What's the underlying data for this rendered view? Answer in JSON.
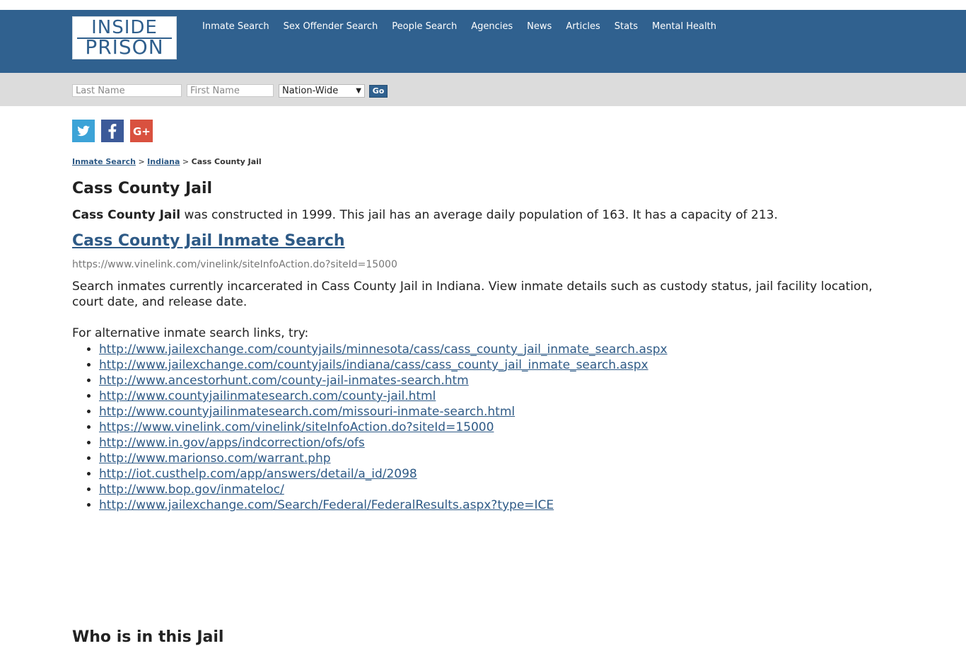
{
  "header": {
    "logo_line1": "INSIDE",
    "logo_line2": "PRISON",
    "nav": [
      "Inmate Search",
      "Sex Offender Search",
      "People Search",
      "Agencies",
      "News",
      "Articles",
      "Stats",
      "Mental Health"
    ]
  },
  "search": {
    "last_placeholder": "Last Name",
    "first_placeholder": "First Name",
    "scope_selected": "Nation-Wide",
    "go_label": "Go"
  },
  "social": [
    "twitter-icon",
    "facebook-icon",
    "google-plus-icon"
  ],
  "breadcrumb": {
    "root": "Inmate Search",
    "sep1": ">",
    "state": "Indiana",
    "sep2": ">",
    "current": "Cass County Jail"
  },
  "page": {
    "title": "Cass County Jail",
    "intro_name": "Cass County Jail",
    "intro_rest": " was constructed in 1999. This jail has an average daily population of 163. It has a capacity of 213.",
    "search_link": "Cass County Jail Inmate Search",
    "search_url": "https://www.vinelink.com/vinelink/siteInfoAction.do?siteId=15000",
    "description": "Search inmates currently incarcerated in Cass County Jail in Indiana. View inmate details such as custody status, jail facility location, court date, and release date.",
    "alt_intro": "For alternative inmate search links, try:",
    "alt_links": [
      "http://www.jailexchange.com/countyjails/minnesota/cass/cass_county_jail_inmate_search.aspx",
      "http://www.jailexchange.com/countyjails/indiana/cass/cass_county_jail_inmate_search.aspx",
      "http://www.ancestorhunt.com/county-jail-inmates-search.htm",
      "http://www.countyjailinmatesearch.com/county-jail.html",
      "http://www.countyjailinmatesearch.com/missouri-inmate-search.html",
      "https://www.vinelink.com/vinelink/siteInfoAction.do?siteId=15000",
      "http://www.in.gov/apps/indcorrection/ofs/ofs",
      "http://www.marionso.com/warrant.php",
      "http://iot.custhelp.com/app/answers/detail/a_id/2098",
      "http://www.bop.gov/inmateloc/",
      "http://www.jailexchange.com/Search/Federal/FederalResults.aspx?type=ICE"
    ],
    "section2_title": "Who is in this Jail"
  }
}
